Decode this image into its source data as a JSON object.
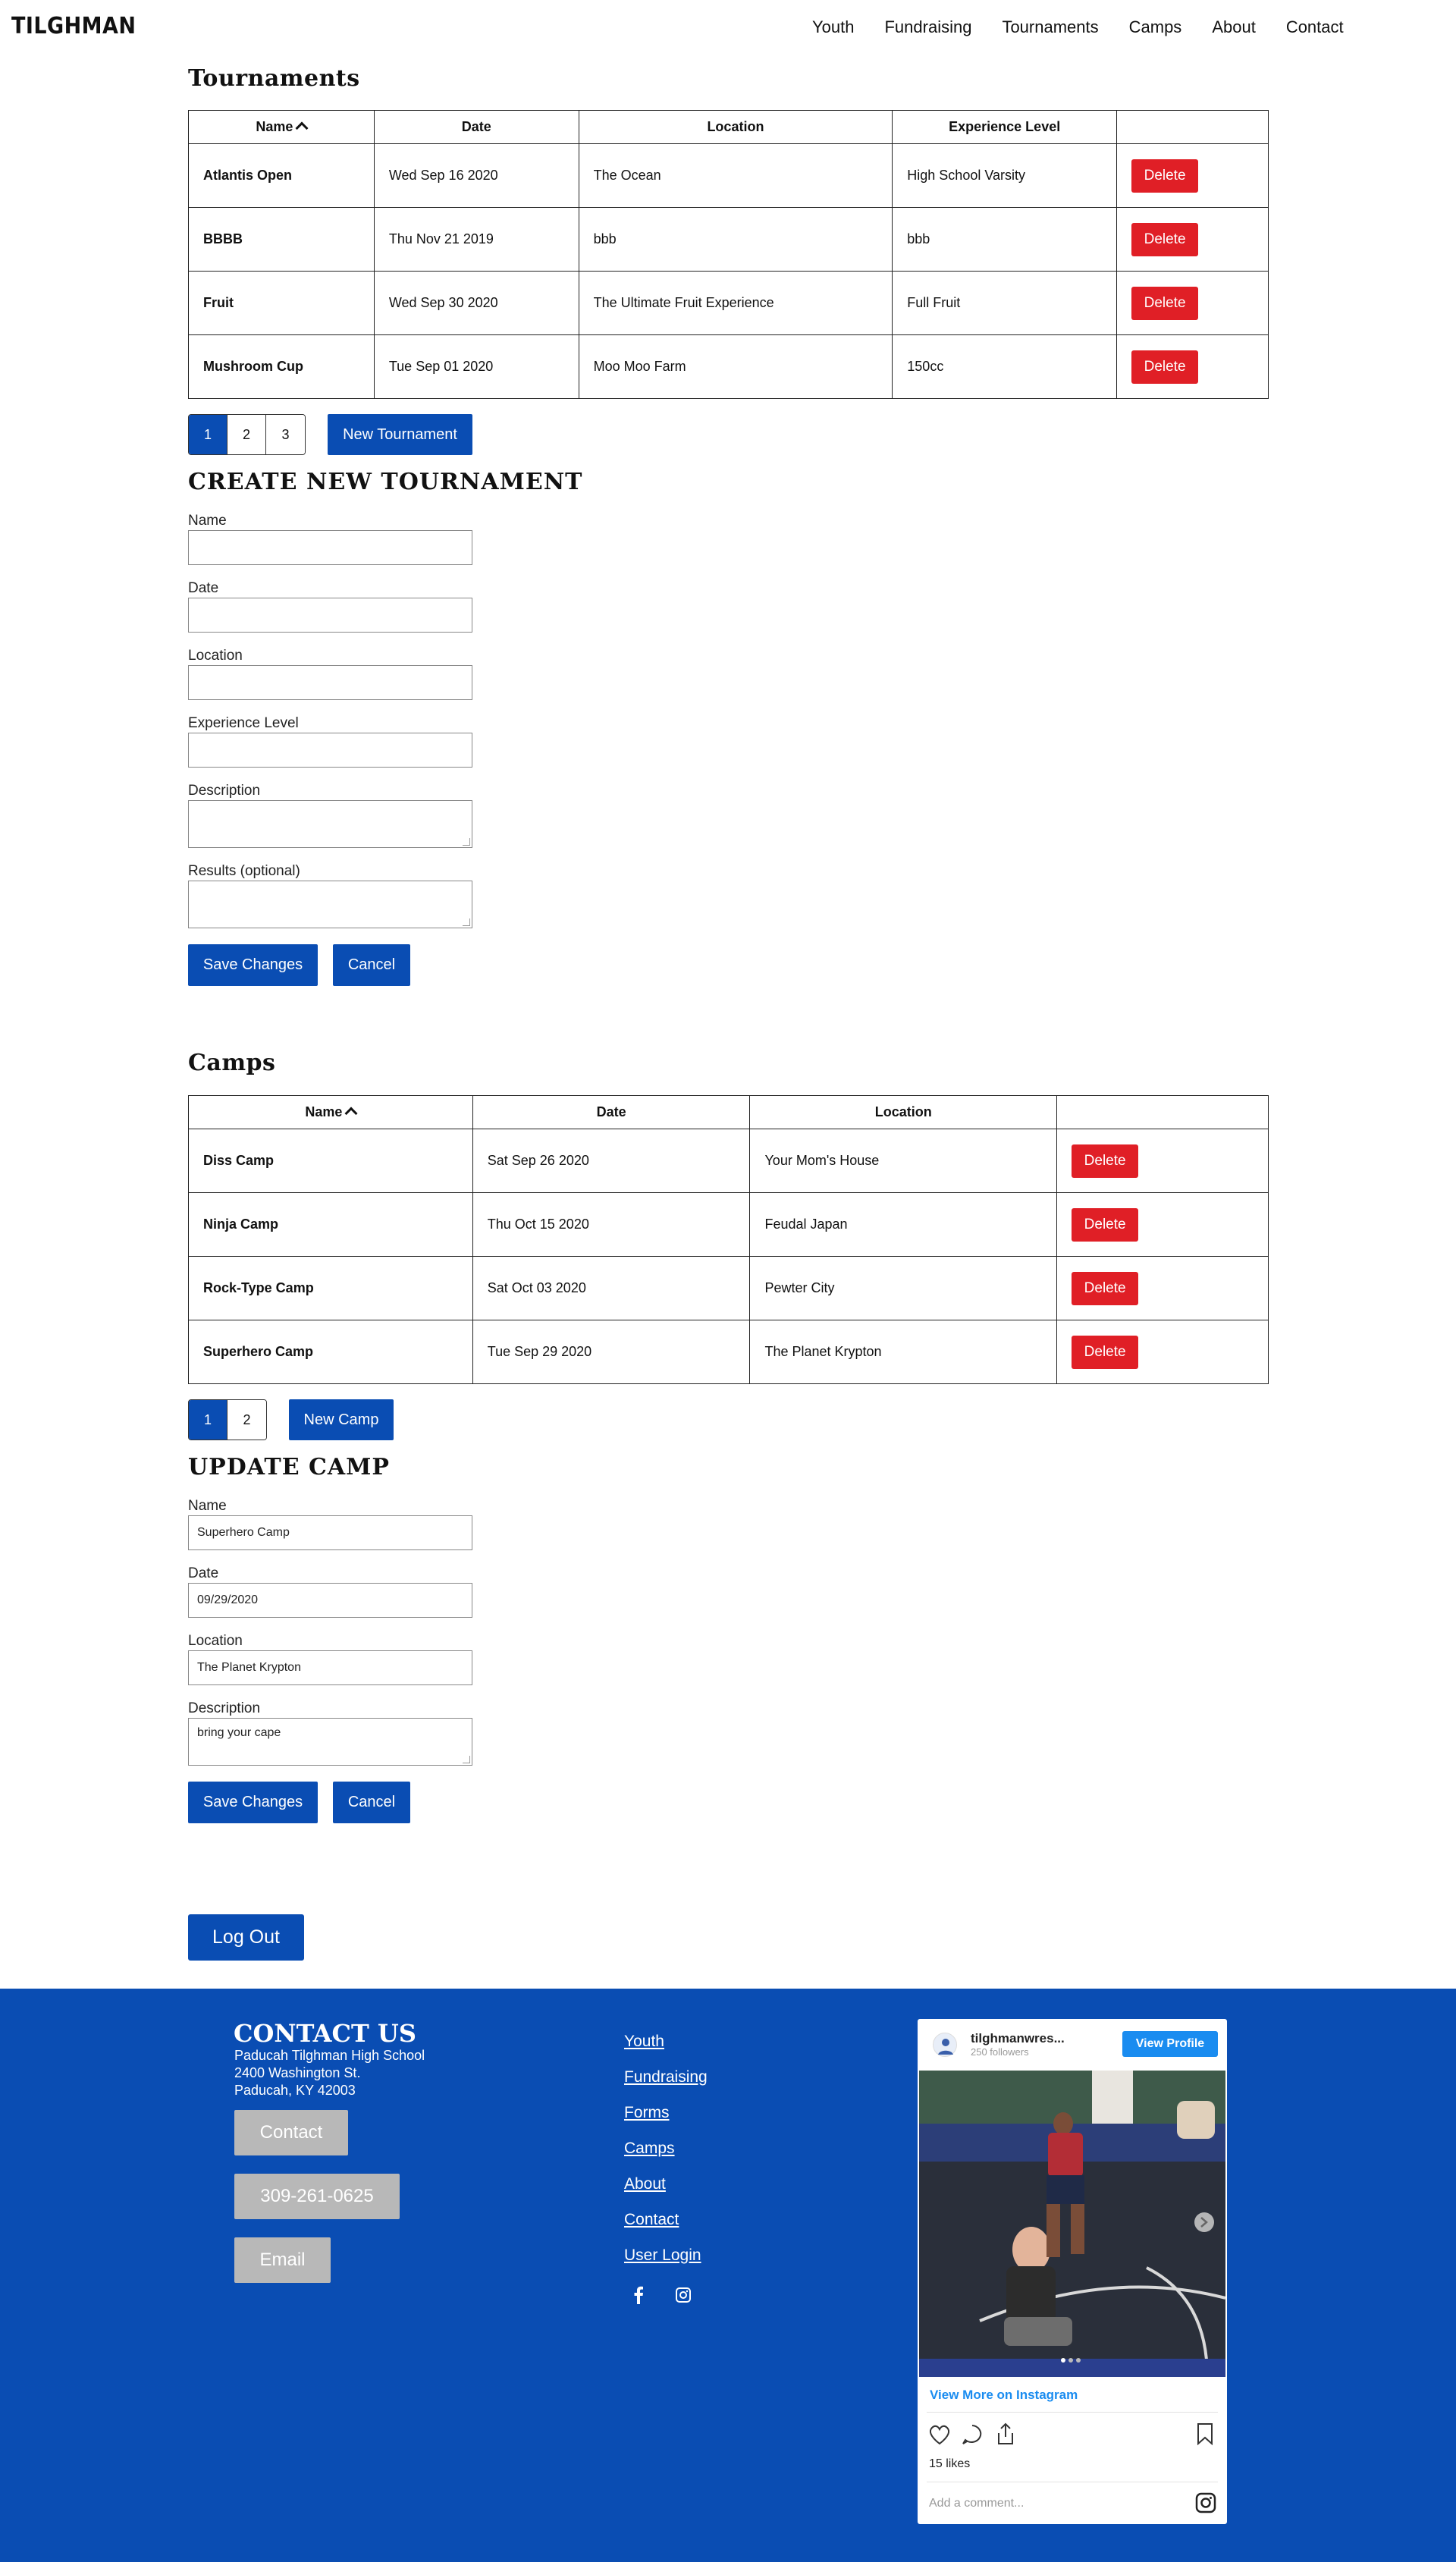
{
  "nav": {
    "brand": "TILGHMAN",
    "links": [
      "Youth",
      "Fundraising",
      "Tournaments",
      "Camps",
      "About",
      "Contact"
    ]
  },
  "tournaments": {
    "title": "Tournaments",
    "headers": [
      "Name",
      "Date",
      "Location",
      "Experience Level",
      ""
    ],
    "rows": [
      {
        "name": "Atlantis Open",
        "date": "Wed Sep 16 2020",
        "location": "The Ocean",
        "level": "High School Varsity"
      },
      {
        "name": "BBBB",
        "date": "Thu Nov 21 2019",
        "location": "bbb",
        "level": "bbb"
      },
      {
        "name": "Fruit",
        "date": "Wed Sep 30 2020",
        "location": "The Ultimate Fruit Experience",
        "level": "Full Fruit"
      },
      {
        "name": "Mushroom Cup",
        "date": "Tue Sep 01 2020",
        "location": "Moo Moo Farm",
        "level": "150cc"
      }
    ],
    "delete_label": "Delete",
    "pages": [
      "1",
      "2",
      "3"
    ],
    "new_label": "New Tournament"
  },
  "create_tournament": {
    "title": "CREATE NEW TOURNAMENT",
    "fields": {
      "name": {
        "label": "Name",
        "value": ""
      },
      "date": {
        "label": "Date",
        "value": ""
      },
      "location": {
        "label": "Location",
        "value": ""
      },
      "level": {
        "label": "Experience Level",
        "value": ""
      },
      "description": {
        "label": "Description",
        "value": ""
      },
      "results": {
        "label": "Results (optional)",
        "value": ""
      }
    },
    "save_label": "Save Changes",
    "cancel_label": "Cancel"
  },
  "camps": {
    "title": "Camps",
    "headers": [
      "Name",
      "Date",
      "Location",
      ""
    ],
    "rows": [
      {
        "name": "Diss Camp",
        "date": "Sat Sep 26 2020",
        "location": "Your Mom's House"
      },
      {
        "name": "Ninja Camp",
        "date": "Thu Oct 15 2020",
        "location": "Feudal Japan"
      },
      {
        "name": "Rock-Type Camp",
        "date": "Sat Oct 03 2020",
        "location": "Pewter City"
      },
      {
        "name": "Superhero Camp",
        "date": "Tue Sep 29 2020",
        "location": "The Planet Krypton"
      }
    ],
    "delete_label": "Delete",
    "pages": [
      "1",
      "2"
    ],
    "new_label": "New Camp"
  },
  "update_camp": {
    "title": "UPDATE CAMP",
    "fields": {
      "name": {
        "label": "Name",
        "value": "Superhero Camp"
      },
      "date": {
        "label": "Date",
        "value": "09/29/2020"
      },
      "location": {
        "label": "Location",
        "value": "The Planet Krypton"
      },
      "description": {
        "label": "Description",
        "value": "bring your cape"
      }
    },
    "save_label": "Save Changes",
    "cancel_label": "Cancel"
  },
  "logout_label": "Log Out",
  "footer": {
    "contact_title": "CONTACT US",
    "address": [
      "Paducah Tilghman High School",
      "2400 Washington St.",
      "Paducah, KY 42003"
    ],
    "contact_button": "Contact",
    "phone_button": "309-261-0625",
    "email_button": "Email",
    "links": [
      "Youth",
      "Fundraising",
      "Forms",
      "Camps",
      "About",
      "Contact",
      "User Login"
    ],
    "social": {
      "facebook_icon": "facebook-icon",
      "instagram_icon": "instagram-icon"
    },
    "instagram": {
      "username": "tilghmanwres...",
      "followers": "250 followers",
      "view_profile": "View Profile",
      "view_more": "View More on Instagram",
      "likes": "15 likes",
      "comment_placeholder": "Add a comment..."
    }
  },
  "colors": {
    "primary": "#0a4db3",
    "danger": "#e01f26",
    "grey_button": "#b8b8b8",
    "instagram_blue": "#1a8cf0"
  }
}
